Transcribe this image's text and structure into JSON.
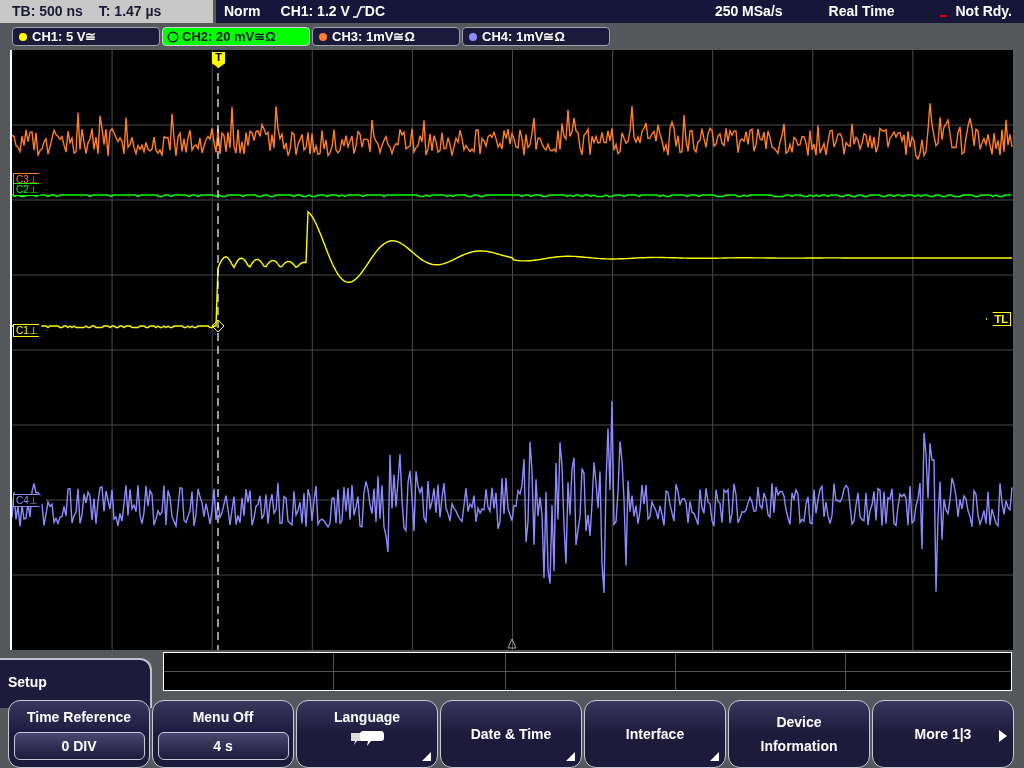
{
  "status_bar": {
    "timebase": "TB: 500 ns",
    "trigger_time": "T: 1.47 µs",
    "mode": "Norm",
    "trigger_source": "CH1: 1.2 V",
    "trigger_coupling": "DC",
    "sample_rate": "250 MSa/s",
    "acquisition": "Real Time",
    "state": "Not Rdy."
  },
  "channels": [
    {
      "label": "CH1: 5 V≅",
      "color": "#ffff00",
      "selected": false
    },
    {
      "label": "CH2: 20 mV≅Ω",
      "color": "#00ff00",
      "selected": true
    },
    {
      "label": "CH3: 1mV≅Ω",
      "color": "#ff7f2a",
      "selected": false
    },
    {
      "label": "CH4: 1mV≅Ω",
      "color": "#8c8cff",
      "selected": false
    }
  ],
  "markers": [
    {
      "label": "C3⊥",
      "color": "#ff7f2a"
    },
    {
      "label": "C2⊥",
      "color": "#00ff00"
    },
    {
      "label": "C1⊥",
      "color": "#ffff00"
    },
    {
      "label": "C4⊥",
      "color": "#8c8cff"
    }
  ],
  "trigger_marker": "T",
  "trigger_level_marker": "TL",
  "menu": {
    "title": "Setup",
    "buttons": [
      {
        "kind": "value",
        "label": "Time Reference",
        "value": "0 DIV"
      },
      {
        "kind": "value",
        "label": "Menu Off",
        "value": "4 s"
      },
      {
        "kind": "language",
        "label": "Language"
      },
      {
        "kind": "submenu",
        "label": "Date & Time"
      },
      {
        "kind": "submenu",
        "label": "Interface"
      },
      {
        "kind": "plain",
        "label": "Device Information"
      },
      {
        "kind": "next",
        "label": "More 1|3"
      }
    ]
  }
}
